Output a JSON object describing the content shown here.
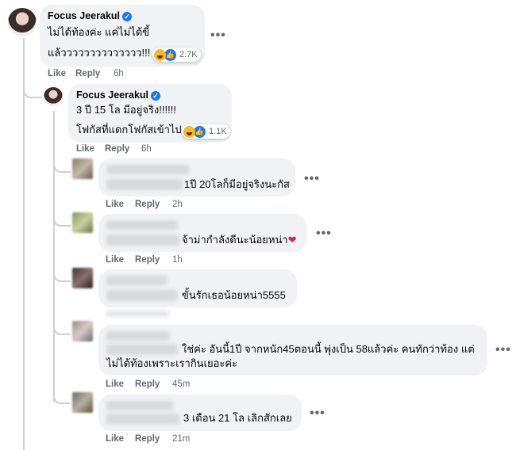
{
  "comments": [
    {
      "name": "Focus Jeerakul",
      "verified": true,
      "line1": "ไม่ได้ท้องค่ะ แค่ไม่ได้ขี้",
      "line2": "แล้วววววววววววววว!!!",
      "reaction_count": "2.7K",
      "like": "Like",
      "reply": "Reply",
      "time": "6h"
    },
    {
      "name": "Focus Jeerakul",
      "verified": true,
      "line1": "3 ปี 15 โล มีอยู่จริง!!!!!!",
      "line2": "โฟกัสที่แดกโฟกัสเข้าไป",
      "reaction_count": "1.1K",
      "like": "Like",
      "reply": "Reply",
      "time": "6h"
    },
    {
      "text": "1ปี 20โลก็มีอยู่จริงนะกัส",
      "like": "Like",
      "reply": "Reply",
      "time": "2h"
    },
    {
      "text": "จ้าม่ากำลังดีนะน้อยหน่า",
      "like": "Like",
      "reply": "Reply",
      "time": "1h"
    },
    {
      "text": "ขั้นรักเธอน้อยหน่า5555",
      "like": "Like",
      "reply": "Reply",
      "time": ""
    },
    {
      "line1": "ใช่ค่ะ อันนี้1ปี จากหนัก45ตอนนี้ พุ่งเป็น 58แล้วค่ะ คนทักว่าท้อง แต่",
      "line2": "ไม่ได้ท้องเพราะเรากินเยอะค่ะ",
      "like": "Like",
      "reply": "Reply",
      "time": "45m"
    },
    {
      "text": "3 เดือน 21 โล เลิกสักเลย",
      "like": "Like",
      "reply": "Reply",
      "time": "21m"
    }
  ],
  "icons": {
    "more": "•••",
    "verified": "✓",
    "like_reaction": "👍",
    "heart": "❤"
  },
  "colors": {
    "bubble": "#f0f2f5",
    "verified": "#1877f2",
    "meta": "#65676b",
    "heart": "#e41e3f"
  }
}
